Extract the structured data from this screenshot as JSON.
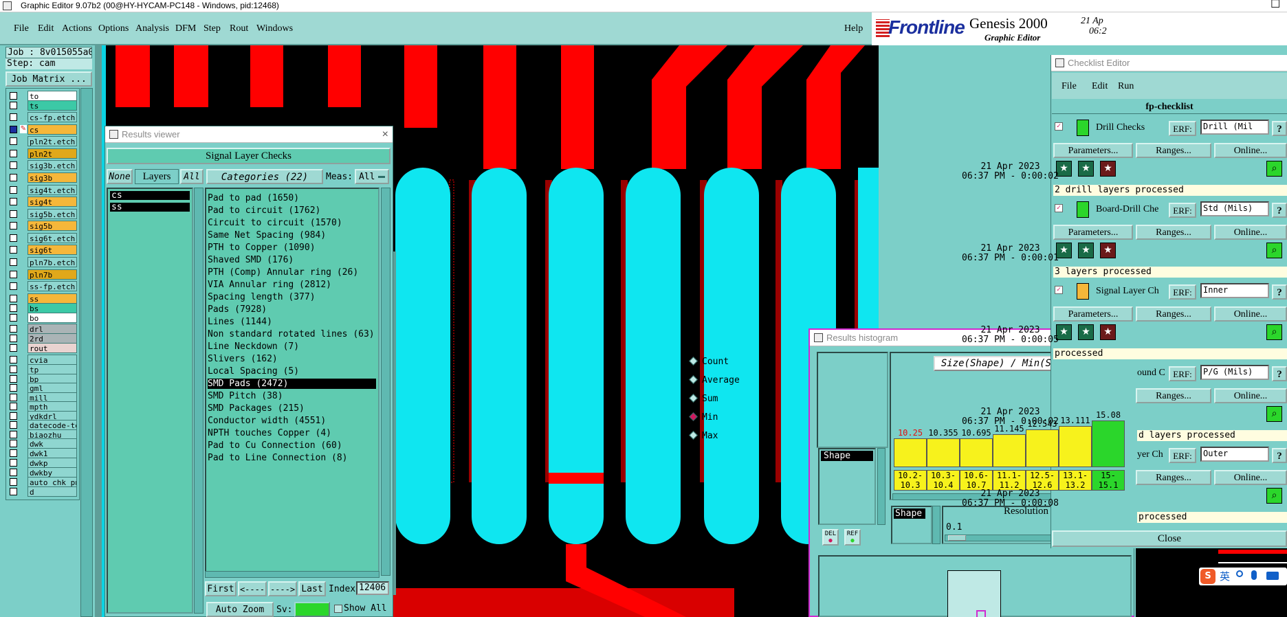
{
  "window": {
    "title": "Graphic Editor 9.07b2 (00@HY-HYCAM-PC148 - Windows, pid:12468)",
    "maximize_glyph": "☐"
  },
  "menubar": {
    "items": [
      "File",
      "Edit",
      "Actions",
      "Options",
      "Analysis",
      "DFM",
      "Step",
      "Rout",
      "Windows"
    ],
    "help": "Help"
  },
  "brand": {
    "logo": "Frontline",
    "product": "Genesis 2000",
    "subtitle": "Graphic Editor",
    "date": "21 Ap",
    "time": "06:2"
  },
  "job": {
    "job_label": "Job : 8v015055a0",
    "step_label": "Step: cam",
    "matrix_button": "Job Matrix ..."
  },
  "layers": [
    {
      "name": "to",
      "color": "#ffffff"
    },
    {
      "name": "ts",
      "color": "#3cc9a6"
    },
    {
      "name": "cs-fp.etch",
      "color": "#8fd6d0"
    },
    {
      "name": "cs",
      "color": "#f5b73a"
    },
    {
      "name": "pln2t.etch",
      "color": "#8fd6d0"
    },
    {
      "name": "pln2t",
      "color": "#e0a81a"
    },
    {
      "name": "sig3b.etch",
      "color": "#8fd6d0"
    },
    {
      "name": "sig3b",
      "color": "#f5b73a"
    },
    {
      "name": "sig4t.etch",
      "color": "#8fd6d0"
    },
    {
      "name": "sig4t",
      "color": "#f5b73a"
    },
    {
      "name": "sig5b.etch",
      "color": "#8fd6d0"
    },
    {
      "name": "sig5b",
      "color": "#f5b73a"
    },
    {
      "name": "sig6t.etch",
      "color": "#8fd6d0"
    },
    {
      "name": "sig6t",
      "color": "#f5b73a"
    },
    {
      "name": "pln7b.etch",
      "color": "#8fd6d0"
    },
    {
      "name": "pln7b",
      "color": "#e0a81a"
    },
    {
      "name": "ss-fp.etch",
      "color": "#8fd6d0"
    },
    {
      "name": "ss",
      "color": "#f5b73a"
    },
    {
      "name": "bs",
      "color": "#3cc9a6"
    },
    {
      "name": "bo",
      "color": "#ffffff"
    },
    {
      "name": "drl",
      "color": "#aab4b6"
    },
    {
      "name": "2rd",
      "color": "#aab4b6"
    },
    {
      "name": "rout",
      "color": "#e9d3d0"
    },
    {
      "name": "cvia",
      "color": "#8fd6d0"
    },
    {
      "name": "tp",
      "color": "#8fd6d0"
    },
    {
      "name": "bp",
      "color": "#8fd6d0"
    },
    {
      "name": "gml",
      "color": "#8fd6d0"
    },
    {
      "name": "mill",
      "color": "#8fd6d0"
    },
    {
      "name": "mpth",
      "color": "#8fd6d0"
    },
    {
      "name": "ydkdrl",
      "color": "#8fd6d0"
    },
    {
      "name": "datecode-to",
      "color": "#8fd6d0"
    },
    {
      "name": "biaozhu",
      "color": "#8fd6d0"
    },
    {
      "name": "dwk",
      "color": "#8fd6d0"
    },
    {
      "name": "dwk1",
      "color": "#8fd6d0"
    },
    {
      "name": "dwkp",
      "color": "#8fd6d0"
    },
    {
      "name": "dwkby",
      "color": "#8fd6d0"
    },
    {
      "name": "auto_chk_pn",
      "color": "#8fd6d0"
    },
    {
      "name": "d",
      "color": "#8fd6d0"
    }
  ],
  "results_viewer": {
    "title": "Results viewer",
    "close_glyph": "×",
    "header": "Signal Layer Checks",
    "none_btn": "None",
    "layers_label": "Layers",
    "all_btn": "All",
    "categories_label": "Categories (22)",
    "meas_label": "Meas:",
    "meas_value": "All",
    "selected_layers": [
      "cs",
      "ss"
    ],
    "categories": [
      "Pad to pad (1650)",
      "Pad to circuit (1762)",
      "Circuit to circuit (1570)",
      "Same Net Spacing (984)",
      "PTH to Copper (1090)",
      "Shaved SMD (176)",
      "PTH (Comp) Annular ring (26)",
      "VIA Annular ring (2812)",
      "Spacing length (377)",
      "Pads (7928)",
      "Lines (1144)",
      "Non standard rotated lines (63)",
      "Line Neckdown (7)",
      "Slivers (162)",
      "Local Spacing (5)",
      "SMD Pads (2472)",
      "SMD Pitch (38)",
      "SMD Packages (215)",
      "Conductor width (4551)",
      "NPTH touches Copper (4)",
      "Pad to Cu Connection (60)",
      "Pad to Line Connection (8)"
    ],
    "selected_category": "SMD Pads (2472)",
    "first_btn": "First",
    "prev_btn": "<----",
    "next_btn": "---->",
    "last_btn": "Last",
    "index_label": "Index:",
    "index_value": "12406",
    "zoom_btn": "Auto Zoom",
    "sv_label": "Sv:",
    "show_all_label": "Show All"
  },
  "histogram": {
    "title": "Results histogram",
    "close_glyph": "×",
    "metric_title": "Size(Shape) / Min(Shape)",
    "options": [
      {
        "label": "Count",
        "on": false
      },
      {
        "label": "Average",
        "on": false
      },
      {
        "label": "Sum",
        "on": false
      },
      {
        "label": "Min",
        "on": true
      },
      {
        "label": "Max",
        "on": false
      }
    ],
    "attribute_item": "Shape",
    "attribute_item2": "Shape",
    "resolution_label": "Resolution",
    "resolution_value": "0.1",
    "del_btn": "DEL",
    "ref_btn": "REF",
    "bars": [
      {
        "value": "10.25",
        "range": "10.2-\n10.3",
        "level": 0.44,
        "color": "#f7f21c",
        "value_color": "#e01010"
      },
      {
        "value": "10.355",
        "range": "10.3-\n10.4",
        "level": 0.44,
        "color": "#f7f21c",
        "value_color": "#000000"
      },
      {
        "value": "10.695",
        "range": "10.6-\n10.7",
        "level": 0.44,
        "color": "#f7f21c",
        "value_color": "#000000"
      },
      {
        "value": "11.145",
        "range": "11.1-\n11.2",
        "level": 0.51,
        "color": "#f7f21c",
        "value_color": "#000000"
      },
      {
        "value": "12.543",
        "range": "12.5-\n12.6",
        "level": 0.58,
        "color": "#f7f21c",
        "value_color": "#000000"
      },
      {
        "value": "13.111",
        "range": "13.1-\n13.2",
        "level": 0.63,
        "color": "#f7f21c",
        "value_color": "#000000"
      },
      {
        "value": "15.08",
        "range": "15-\n15.1",
        "level": 0.72,
        "color": "#2bd62b",
        "value_color": "#000000"
      }
    ]
  },
  "checklist": {
    "title": "Checklist Editor",
    "menu": [
      "File",
      "Edit",
      "Run"
    ],
    "name": "fp-checklist",
    "close_btn": "Close",
    "erf_label": "ERF:",
    "params_btn": "Parameters...",
    "ranges_btn": "Ranges...",
    "online_btn": "Online...",
    "help_glyph": "?",
    "checks": [
      {
        "name": "Drill Checks",
        "erf": "Drill (Mil",
        "date": "21 Apr 2023",
        "time": "06:37 PM - 0:00:02",
        "status": "2 drill layers processed"
      },
      {
        "name": "Board-Drill Che",
        "erf": "Std (Mils)",
        "date": "21 Apr 2023",
        "time": "06:37 PM - 0:00:01",
        "status": "3 layers processed"
      },
      {
        "name": "Signal Layer Ch",
        "erf": "Inner",
        "date": "21 Apr 2023",
        "time": "06:37 PM - 0:00:05",
        "status": "processed"
      },
      {
        "name": "ound C",
        "erf": "P/G (Mils)",
        "date": "21 Apr 2023",
        "time": "06:37 PM - 0:00:02",
        "status": "d layers processed"
      },
      {
        "name": "yer Ch",
        "erf": "Outer",
        "date": "21 Apr 2023",
        "time": "06:37 PM - 0:00:08",
        "status": "processed"
      }
    ]
  },
  "tray": {
    "ime_label": "英"
  },
  "icons": [
    "app-icon",
    "checkbox-icon",
    "layer-edit-icon",
    "run-check-icon",
    "zoom-icon",
    "close-icon",
    "drill-icon",
    "microphone-icon",
    "keyboard-icon"
  ]
}
